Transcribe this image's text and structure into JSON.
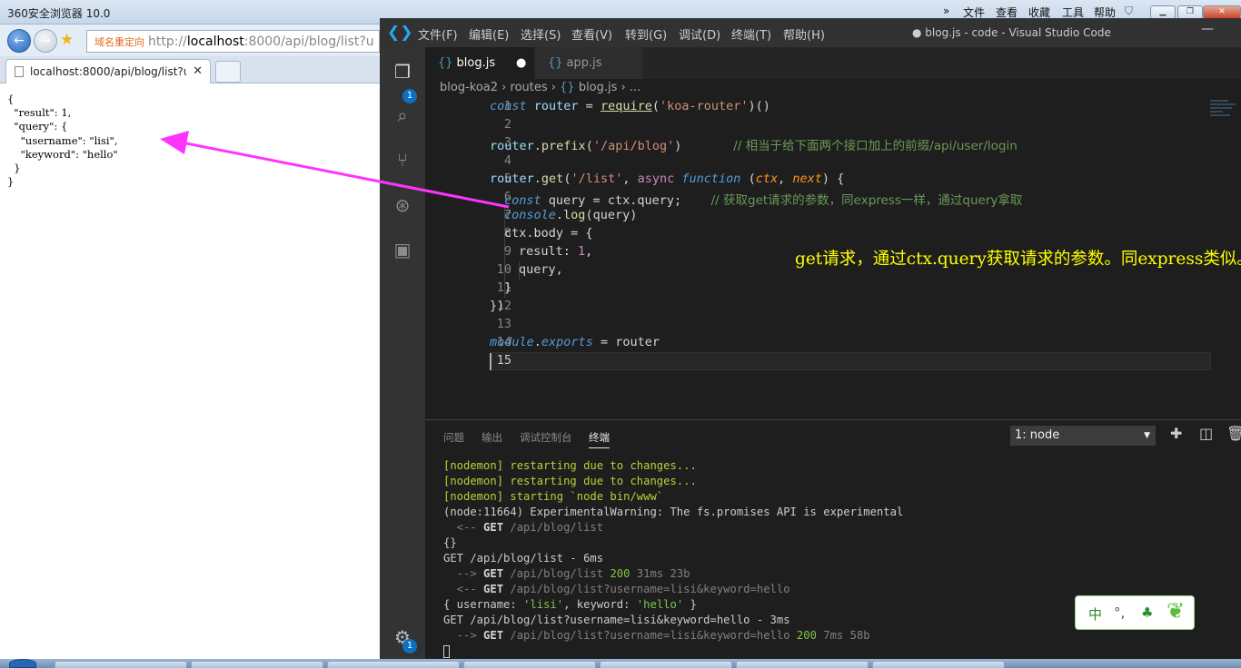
{
  "browser": {
    "title": "360安全浏览器 10.0",
    "menu": [
      "»",
      "文件",
      "查看",
      "收藏",
      "工具",
      "帮助"
    ],
    "redirect_label": "域名重定向",
    "url_prefix": "http://",
    "url_host": "localhost",
    "url_rest": ":8000/api/blog/list?u",
    "tab_title": "localhost:8000/api/blog/list?u",
    "tab_close": "✕",
    "json_lines": [
      "{",
      "  \"result\": 1,",
      "  \"query\": {",
      "    \"username\": \"lisi\",",
      "    \"keyword\": \"hello\"",
      "  }",
      "}"
    ]
  },
  "vscode": {
    "menu": [
      "文件(F)",
      "编辑(E)",
      "选择(S)",
      "查看(V)",
      "转到(G)",
      "调试(D)",
      "终端(T)",
      "帮助(H)"
    ],
    "window_title": "● blog.js - code - Visual Studio Code",
    "badge_explorer": "1",
    "badge_settings": "1",
    "tabs": [
      {
        "label": "blog.js",
        "active": true,
        "dirty": "●"
      },
      {
        "label": "app.js",
        "active": false
      }
    ],
    "breadcrumb": [
      "blog-koa2",
      "›",
      "routes",
      "›",
      "blog.js",
      "›",
      "..."
    ],
    "line_numbers": [
      "1",
      "2",
      "3",
      "4",
      "5",
      "6",
      "7",
      "8",
      "9",
      "10",
      "11",
      "12",
      "13",
      "14",
      "15"
    ],
    "code": {
      "l1": {
        "a": "const",
        "b": " router ",
        "c": "=",
        "d": " ",
        "e": "require",
        "f": "(",
        "g": "'koa-router'",
        "h": ")()"
      },
      "l3": {
        "a": "router",
        "b": ".",
        "c": "prefix",
        "d": "(",
        "e": "'/api/blog'",
        "f": ")",
        "g": "       ",
        "h": "// 相当于给下面两个接口加上的前缀/api/user/login"
      },
      "l5": {
        "a": "router",
        "b": ".",
        "c": "get",
        "d": "(",
        "e": "'/list'",
        "f": ", ",
        "g": "async",
        "h": " ",
        "i": "function",
        "j": " (",
        "k": "ctx",
        "l": ", ",
        "m": "next",
        "n": ") {"
      },
      "l6": {
        "a": "const",
        "b": " query ",
        "c": "=",
        "d": " ctx.query;",
        "e": "    ",
        "f": "// 获取get请求的参数，同express一样，通过query拿取"
      },
      "l7": {
        "a": "console",
        "b": ".",
        "c": "log",
        "d": "(query)"
      },
      "l8": {
        "a": "ctx.body ",
        "b": "=",
        "c": " {"
      },
      "l9": {
        "a": "result: ",
        "b": "1",
        "c": ","
      },
      "l10": "query,",
      "l11": "}",
      "l12": "})",
      "l14": {
        "a": "module",
        "b": ".",
        "c": "exports",
        "d": " ",
        "e": "=",
        "f": " router"
      }
    },
    "annotation": "get请求，通过ctx.query获取请求的参数。同express类似。",
    "panel": {
      "tabs": [
        "问题",
        "输出",
        "调试控制台",
        "终端"
      ],
      "active_tab": "终端",
      "terminal_select": "1: node",
      "terminal": {
        "t1": "[nodemon] restarting due to changes...",
        "t2": "[nodemon] restarting due to changes...",
        "t3": "[nodemon] starting `node bin/www`",
        "t4": "(node:11664) ExperimentalWarning: The fs.promises API is experimental",
        "t5a": "  <-- ",
        "t5b": "GET",
        "t5c": " /api/blog/list",
        "t6": "{}",
        "t7": "GET /api/blog/list - 6ms",
        "t8a": "  --> ",
        "t8b": "GET",
        "t8c": " /api/blog/list ",
        "t8d": "200",
        "t8e": " 31ms 23b",
        "t9a": "  <-- ",
        "t9b": "GET",
        "t9c": " /api/blog/list?username=lisi&keyword=hello",
        "t10a": "{ username: ",
        "t10b": "'lisi'",
        "t10c": ", keyword: ",
        "t10d": "'hello'",
        "t10e": " }",
        "t11": "GET /api/blog/list?username=lisi&keyword=hello - 3ms",
        "t12a": "  --> ",
        "t12b": "GET",
        "t12c": " /api/blog/list?username=lisi&keyword=hello ",
        "t12d": "200",
        "t12e": " 7ms 58b"
      }
    }
  },
  "ime": {
    "lang": "中",
    "punct": "°,",
    "skin": "👕"
  },
  "colors": {
    "annotation": "#ffff00",
    "arrow": "#ff33ff",
    "vscode_bg": "#1e1e1e",
    "badge": "#0e70c0"
  }
}
